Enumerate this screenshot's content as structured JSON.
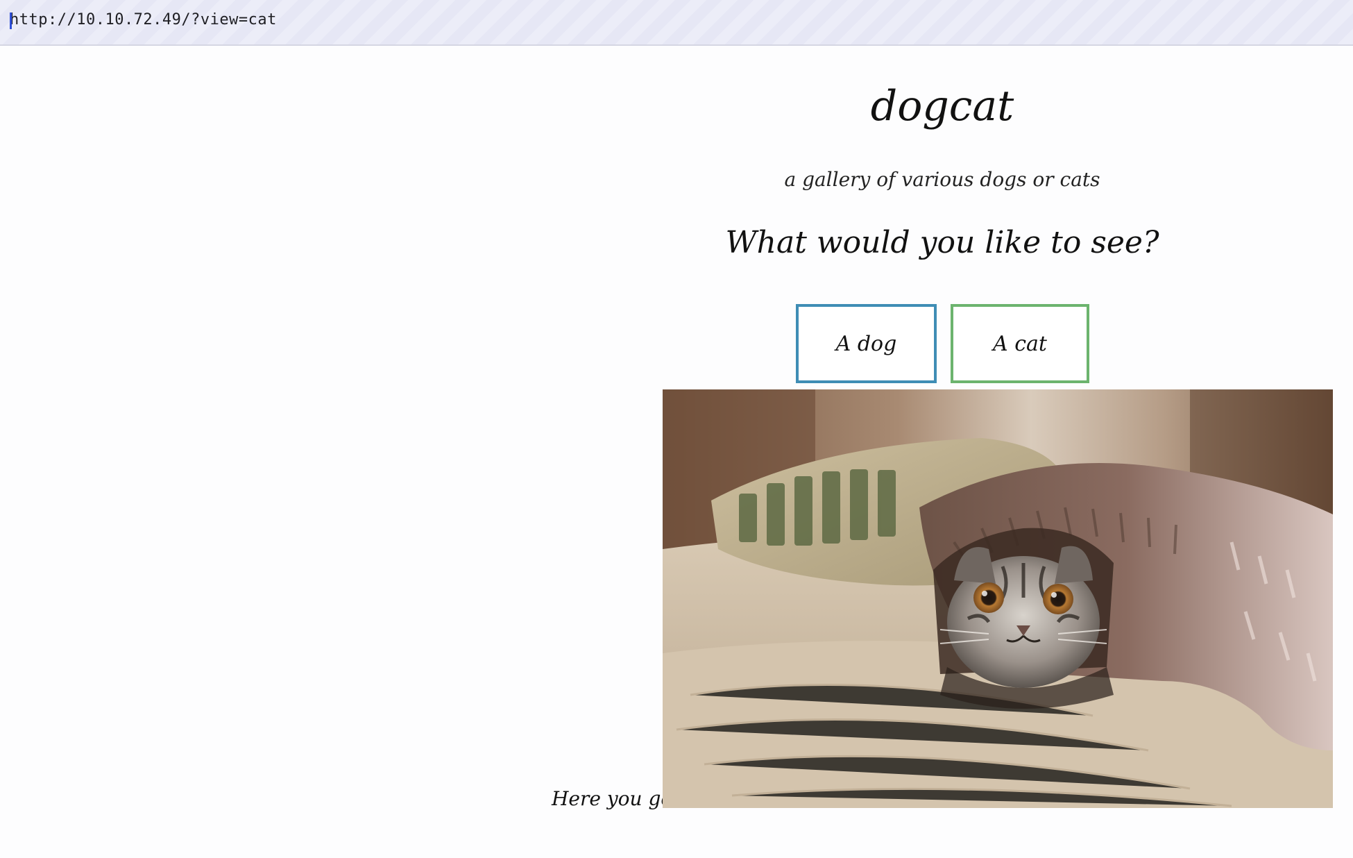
{
  "browser": {
    "url": "http://10.10.72.49/?view=cat"
  },
  "page": {
    "title": "dogcat",
    "subtitle": "a gallery of various dogs or cats",
    "prompt": "What would you like to see?",
    "buttons": {
      "dog_label": "A dog",
      "cat_label": "A cat"
    },
    "caption": "Here you go!",
    "image": {
      "subject": "cat-photo"
    }
  },
  "colors": {
    "dog_button_border": "#3f8db5",
    "cat_button_border": "#6cb46e"
  }
}
